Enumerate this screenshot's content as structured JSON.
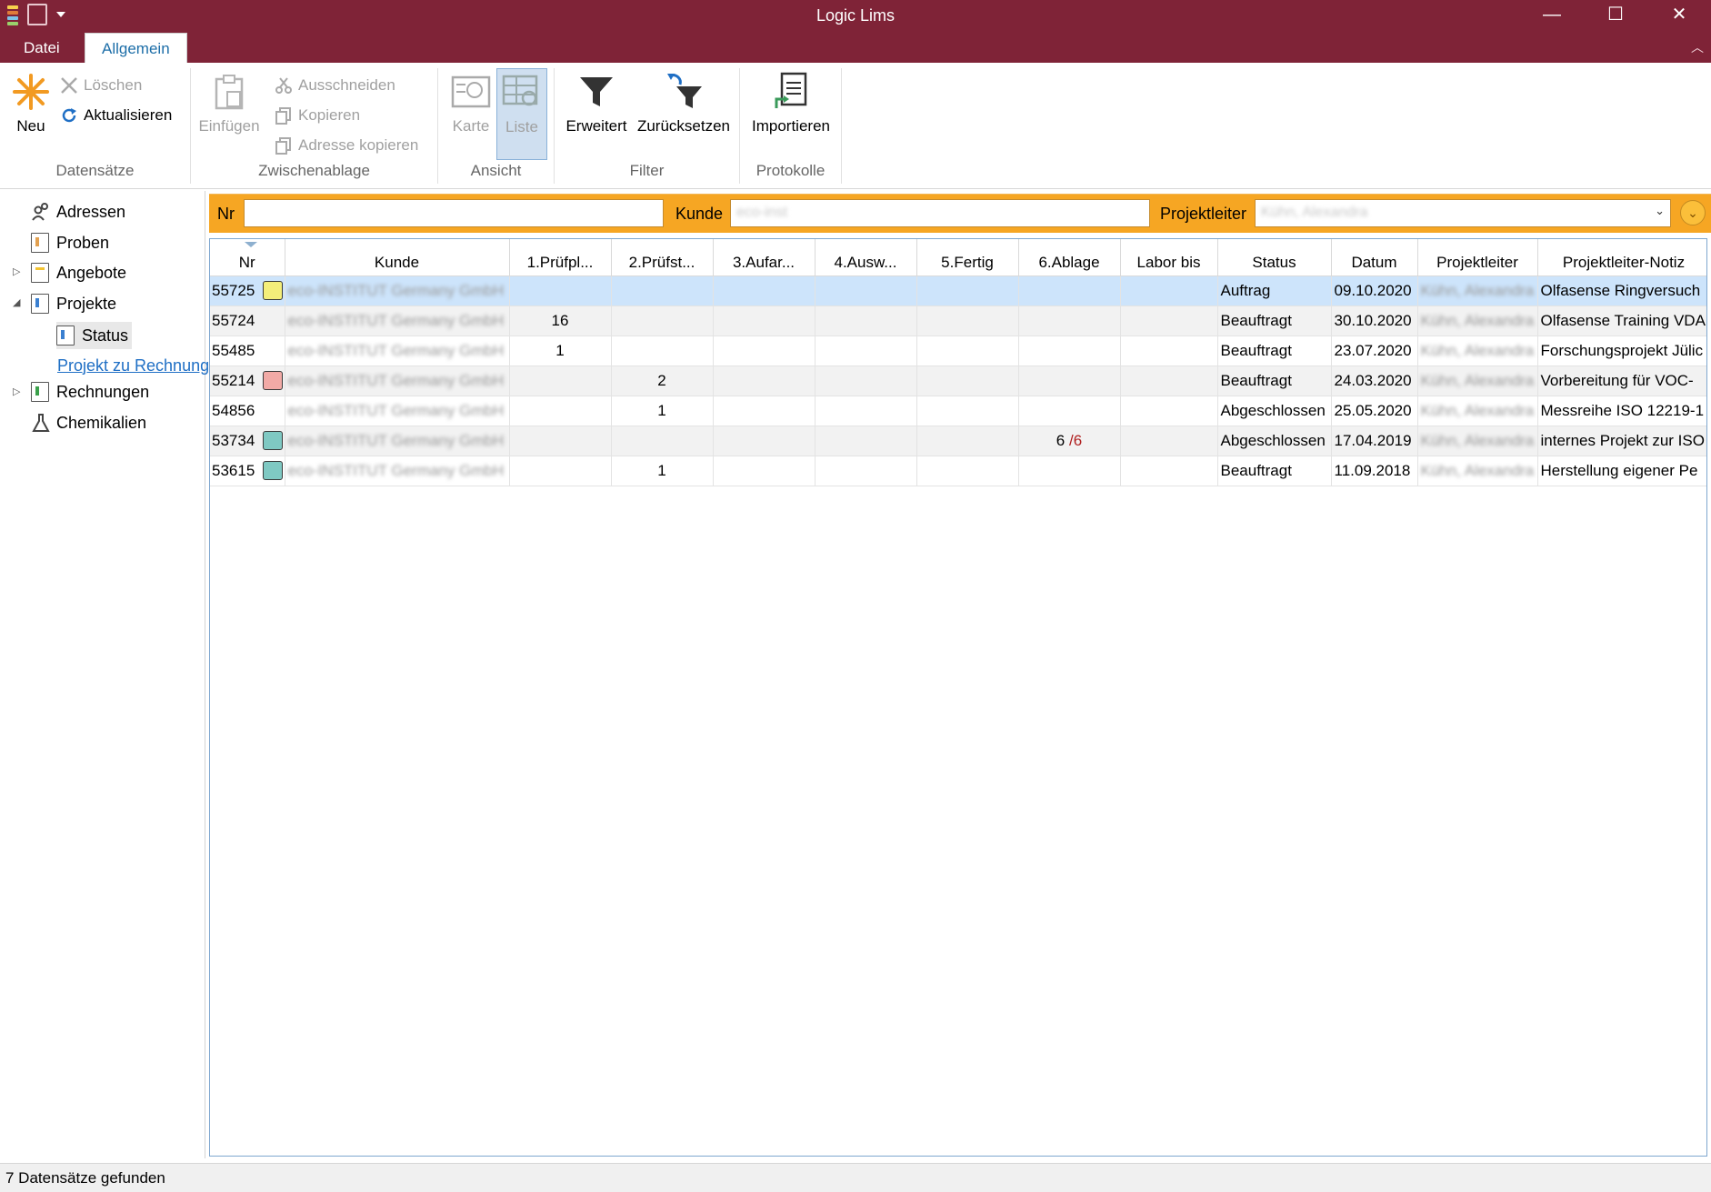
{
  "window": {
    "title": "Logic Lims",
    "minimize": "—",
    "maximize": "☐",
    "close": "✕"
  },
  "tabs": [
    {
      "label": "Datei"
    },
    {
      "label": "Allgemein"
    }
  ],
  "ribbon": {
    "datensaetze": {
      "label": "Datensätze",
      "neu": "Neu",
      "loeschen": "Löschen",
      "aktualisieren": "Aktualisieren"
    },
    "zwischenablage": {
      "label": "Zwischenablage",
      "einfuegen": "Einfügen",
      "ausschneiden": "Ausschneiden",
      "kopieren": "Kopieren",
      "adresse_kopieren": "Adresse kopieren"
    },
    "ansicht": {
      "label": "Ansicht",
      "karte": "Karte",
      "liste": "Liste"
    },
    "filter": {
      "label": "Filter",
      "erweitert": "Erweitert",
      "zuruecksetzen": "Zurücksetzen"
    },
    "protokolle": {
      "label": "Protokolle",
      "importieren": "Importieren"
    }
  },
  "nav": {
    "adressen": "Adressen",
    "proben": "Proben",
    "angebote": "Angebote",
    "projekte": "Projekte",
    "status": "Status",
    "projekt_zu_rechnung": "Projekt zu Rechnung",
    "rechnungen": "Rechnungen",
    "chemikalien": "Chemikalien"
  },
  "filterbar": {
    "nr_label": "Nr",
    "nr_value": "",
    "kunde_label": "Kunde",
    "kunde_value": "eco-inst",
    "projektleiter_label": "Projektleiter",
    "projektleiter_value": "Kühn, Alexandra"
  },
  "grid": {
    "columns": [
      "Nr",
      "Kunde",
      "1.Prüfpl...",
      "2.Prüfst...",
      "3.Aufar...",
      "4.Ausw...",
      "5.Fertig",
      "6.Ablage",
      "Labor bis",
      "Status",
      "Datum",
      "Projektleiter",
      "Projektleiter-Notiz"
    ],
    "rows": [
      {
        "nr": "55725",
        "color": "#f4ee7a",
        "kunde": "eco-INSTITUT Germany GmbH",
        "p1": "",
        "p2": "",
        "p3": "",
        "p4": "",
        "p5": "",
        "p6a": "",
        "p6b": "",
        "labor": "",
        "status": "Auftrag",
        "datum": "09.10.2020",
        "pl": "Kühn, Alexandra",
        "notiz": "Olfasense Ringversuch"
      },
      {
        "nr": "55724",
        "color": "",
        "kunde": "eco-INSTITUT Germany GmbH",
        "p1": "16",
        "p2": "",
        "p3": "",
        "p4": "",
        "p5": "",
        "p6a": "",
        "p6b": "",
        "labor": "",
        "status": "Beauftragt",
        "datum": "30.10.2020",
        "pl": "Kühn, Alexandra",
        "notiz": "Olfasense Training VDA"
      },
      {
        "nr": "55485",
        "color": "",
        "kunde": "eco-INSTITUT Germany GmbH",
        "p1": "1",
        "p2": "",
        "p3": "",
        "p4": "",
        "p5": "",
        "p6a": "",
        "p6b": "",
        "labor": "",
        "status": "Beauftragt",
        "datum": "23.07.2020",
        "pl": "Kühn, Alexandra",
        "notiz": "Forschungsprojekt Jülic"
      },
      {
        "nr": "55214",
        "color": "#f2aaa6",
        "kunde": "eco-INSTITUT Germany GmbH",
        "p1": "",
        "p2": "2",
        "p3": "",
        "p4": "",
        "p5": "",
        "p6a": "",
        "p6b": "",
        "labor": "",
        "status": "Beauftragt",
        "datum": "24.03.2020",
        "pl": "Kühn, Alexandra",
        "notiz": "Vorbereitung für VOC-"
      },
      {
        "nr": "54856",
        "color": "",
        "kunde": "eco-INSTITUT Germany GmbH",
        "p1": "",
        "p2": "1",
        "p3": "",
        "p4": "",
        "p5": "",
        "p6a": "",
        "p6b": "",
        "labor": "",
        "status": "Abgeschlossen",
        "datum": "25.05.2020",
        "pl": "Kühn, Alexandra",
        "notiz": "Messreihe ISO 12219-1"
      },
      {
        "nr": "53734",
        "color": "#7fc9c3",
        "kunde": "eco-INSTITUT Germany GmbH",
        "p1": "",
        "p2": "",
        "p3": "",
        "p4": "",
        "p5": "",
        "p6a": "6",
        "p6b": "/6",
        "labor": "",
        "status": "Abgeschlossen",
        "datum": "17.04.2019",
        "pl": "Kühn, Alexandra",
        "notiz": "internes Projekt zur ISO"
      },
      {
        "nr": "53615",
        "color": "#7fc9c3",
        "kunde": "eco-INSTITUT Germany GmbH",
        "p1": "",
        "p2": "1",
        "p3": "",
        "p4": "",
        "p5": "",
        "p6a": "",
        "p6b": "",
        "labor": "",
        "status": "Beauftragt",
        "datum": "11.09.2018",
        "pl": "Kühn, Alexandra",
        "notiz": "Herstellung eigener Pe"
      }
    ]
  },
  "statusbar": {
    "text": "7 Datensätze gefunden"
  }
}
